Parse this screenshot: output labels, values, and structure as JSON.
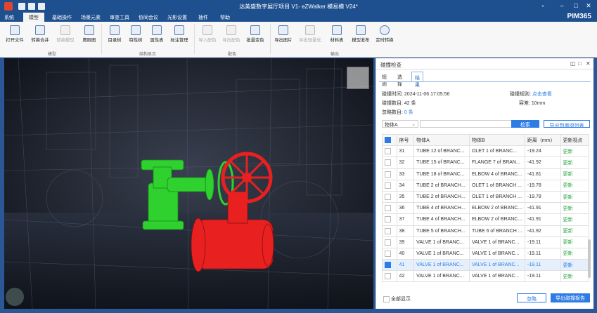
{
  "window": {
    "title": "达美盛数字展厅项目 V1- eZWalker 模易模 V24*",
    "logo": "PIM365"
  },
  "menu": [
    "系统",
    "模型",
    "基础操作",
    "场景元素",
    "审查工具",
    "协同会议",
    "光影设置",
    "插件",
    "帮助"
  ],
  "ribbon": {
    "buttons": [
      "打开文件",
      "转换合并",
      "替换模型",
      "鹰眼图",
      "目录树",
      "特性树",
      "属性表",
      "标注管理",
      "导入配色",
      "导出配色",
      "批量变色",
      "导出图片",
      "导出轻量化",
      "材料表",
      "模型发布",
      "定时转换"
    ],
    "groups": [
      "模型",
      "结构显示",
      "配色",
      "输出"
    ]
  },
  "panel": {
    "title": "碰撞检查",
    "tabs": [
      "规则",
      "选择",
      "结果"
    ],
    "info": {
      "time_label": "碰撞时间:",
      "time_value": "2024-11-06 17:05:56",
      "rule_label": "碰撞规则:",
      "rule_value": "点击查看",
      "count_label": "碰撞数目:",
      "count_value": "42 条",
      "tol_label": "容差:",
      "tol_value": "10mm",
      "ignore_label": "忽略数目:",
      "ignore_value": "0 条"
    },
    "filter_select": "物体A",
    "search_button": "检索",
    "export_review_button": "导出到审阅列表",
    "columns": [
      "序号",
      "物体A",
      "物体B",
      "距离（mm）",
      "更新视点"
    ],
    "rows": [
      {
        "no": "31",
        "a": "TUBE 12 of BRANC...",
        "b": "OLET 1 of BRANC...",
        "d": "-19.24",
        "u": "更新",
        "checked": false
      },
      {
        "no": "32",
        "a": "TUBE 15 of BRANC...",
        "b": "FLANGE 7 of BRAN...",
        "d": "-41.92",
        "u": "更新",
        "checked": false
      },
      {
        "no": "33",
        "a": "TUBE 18 of BRANC...",
        "b": "ELBOW 4 of BRANC...",
        "d": "-41.81",
        "u": "更新",
        "checked": false
      },
      {
        "no": "34",
        "a": "TUBE 2 of BRANCH...",
        "b": "OLET 1 of BRANCH ...",
        "d": "-19.78",
        "u": "更新",
        "checked": false
      },
      {
        "no": "35",
        "a": "TUBE 2 of BRANCH...",
        "b": "OLET 1 of BRANCH ...",
        "d": "-19.78",
        "u": "更新",
        "checked": false
      },
      {
        "no": "36",
        "a": "TUBE 4 of BRANCH...",
        "b": "ELBOW 2 of BRANC...",
        "d": "-41.91",
        "u": "更新",
        "checked": false
      },
      {
        "no": "37",
        "a": "TUBE 4 of BRANCH...",
        "b": "ELBOW 2 of BRANC...",
        "d": "-41.91",
        "u": "更新",
        "checked": false
      },
      {
        "no": "38",
        "a": "TUBE 5 of BRANCH...",
        "b": "TUBE 6 of BRANCH ...",
        "d": "-41.92",
        "u": "更新",
        "checked": false
      },
      {
        "no": "39",
        "a": "VALVE 1 of BRANC...",
        "b": "VALVE 1 of BRANC...",
        "d": "-19.11",
        "u": "更新",
        "checked": false
      },
      {
        "no": "40",
        "a": "VALVE 1 of BRANC...",
        "b": "VALVE 1 of BRANC...",
        "d": "-19.11",
        "u": "更新",
        "checked": false
      },
      {
        "no": "41",
        "a": "VALVE 1 of BRANC...",
        "b": "VALVE 1 of BRANC...",
        "d": "-19.11",
        "u": "更新",
        "checked": true
      },
      {
        "no": "42",
        "a": "VALVE 1 of BRANC...",
        "b": "VALVE 1 of BRANC...",
        "d": "-19.11",
        "u": "更新",
        "checked": false
      }
    ],
    "show_all_label": "全部显示",
    "ignore_button": "忽略",
    "export_report_button": "导出碰撞报告"
  }
}
